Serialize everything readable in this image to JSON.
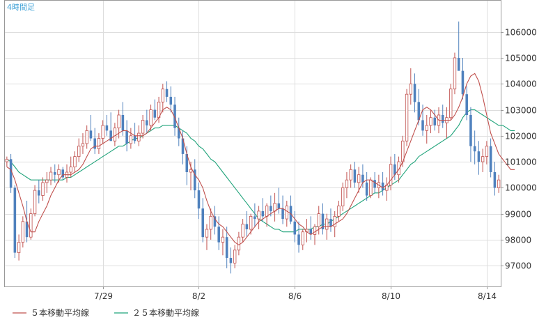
{
  "chart_data": {
    "type": "candlestick",
    "period_label": "4時間足",
    "x_tick_labels": [
      "7/29",
      "8/2",
      "8/6",
      "8/10",
      "8/14"
    ],
    "x_tick_index": [
      24,
      48,
      72,
      96,
      120
    ],
    "ylim": [
      96200,
      107200
    ],
    "y_ticks": [
      97000,
      98000,
      99000,
      100000,
      101000,
      102000,
      103000,
      104000,
      105000,
      106000
    ],
    "grid": true,
    "legend_position": "bottom-left",
    "colors": {
      "up": "#c0504d",
      "down": "#4f81bd",
      "ma5": "#c0504d",
      "ma25": "#1fa37a",
      "grid": "#dddddd",
      "axis": "#999999",
      "period_label": "#3a9fd6"
    },
    "series": [
      {
        "name": "５本移動平均線",
        "key": "ma5"
      },
      {
        "name": "２５本移動平均線",
        "key": "ma25"
      }
    ],
    "candles": [
      [
        101000,
        101200,
        100800,
        101100
      ],
      [
        101100,
        101300,
        99800,
        100000
      ],
      [
        100000,
        100100,
        97300,
        97500
      ],
      [
        97500,
        98200,
        97200,
        97900
      ],
      [
        97900,
        98900,
        97700,
        98700
      ],
      [
        98700,
        99500,
        97900,
        98100
      ],
      [
        98100,
        99200,
        98000,
        99000
      ],
      [
        99000,
        100100,
        98900,
        99900
      ],
      [
        99900,
        100300,
        99400,
        99700
      ],
      [
        99700,
        100400,
        99500,
        100200
      ],
      [
        100200,
        100600,
        99800,
        100300
      ],
      [
        100300,
        100800,
        100100,
        100600
      ],
      [
        100600,
        100900,
        100200,
        100500
      ],
      [
        100500,
        100900,
        100200,
        100700
      ],
      [
        100700,
        100800,
        100300,
        100400
      ],
      [
        100400,
        100900,
        100200,
        100600
      ],
      [
        100600,
        101200,
        100400,
        100800
      ],
      [
        100800,
        101400,
        100600,
        101200
      ],
      [
        101200,
        101900,
        101000,
        101600
      ],
      [
        101600,
        102100,
        101300,
        101700
      ],
      [
        101700,
        102400,
        101500,
        102200
      ],
      [
        102200,
        102800,
        101800,
        101900
      ],
      [
        101900,
        102300,
        101300,
        101500
      ],
      [
        101500,
        102100,
        101300,
        101900
      ],
      [
        101900,
        102600,
        101700,
        102400
      ],
      [
        102400,
        102800,
        102000,
        102200
      ],
      [
        102200,
        102900,
        101800,
        101800
      ],
      [
        101800,
        102500,
        101600,
        102300
      ],
      [
        102300,
        103000,
        101900,
        102800
      ],
      [
        102800,
        103300,
        102000,
        102200
      ],
      [
        102200,
        102600,
        101400,
        101700
      ],
      [
        101700,
        102300,
        101500,
        102000
      ],
      [
        102000,
        102500,
        101700,
        101800
      ],
      [
        101800,
        102400,
        101600,
        102100
      ],
      [
        102100,
        102800,
        101900,
        102600
      ],
      [
        102600,
        103000,
        102100,
        102400
      ],
      [
        102400,
        103200,
        102200,
        103000
      ],
      [
        103000,
        103400,
        102600,
        102700
      ],
      [
        102700,
        103500,
        102500,
        103300
      ],
      [
        103300,
        104000,
        102900,
        103800
      ],
      [
        103800,
        104100,
        103300,
        103500
      ],
      [
        103500,
        103900,
        102900,
        103200
      ],
      [
        103200,
        103500,
        102000,
        102300
      ],
      [
        102300,
        102700,
        101600,
        101900
      ],
      [
        101900,
        102200,
        100900,
        101300
      ],
      [
        101300,
        101600,
        100100,
        100600
      ],
      [
        100600,
        101000,
        99900,
        100700
      ],
      [
        100700,
        101100,
        99600,
        99900
      ],
      [
        99900,
        100200,
        98800,
        99200
      ],
      [
        99200,
        99600,
        97900,
        98100
      ],
      [
        98100,
        98600,
        97600,
        98400
      ],
      [
        98400,
        99200,
        98000,
        98900
      ],
      [
        98900,
        99300,
        98200,
        98500
      ],
      [
        98500,
        98900,
        97600,
        97900
      ],
      [
        97900,
        98400,
        97400,
        98100
      ],
      [
        98100,
        98500,
        96900,
        97300
      ],
      [
        97300,
        97700,
        96700,
        97100
      ],
      [
        97100,
        97800,
        96900,
        97600
      ],
      [
        97600,
        98300,
        97400,
        98100
      ],
      [
        98100,
        98800,
        97900,
        98600
      ],
      [
        98600,
        99100,
        98100,
        98400
      ],
      [
        98400,
        99000,
        98200,
        98900
      ],
      [
        98900,
        99400,
        98500,
        98800
      ],
      [
        98800,
        99300,
        98400,
        99100
      ],
      [
        99100,
        99600,
        98700,
        98900
      ],
      [
        98900,
        99400,
        98500,
        99300
      ],
      [
        99300,
        99700,
        98900,
        99100
      ],
      [
        99100,
        99800,
        98700,
        99400
      ],
      [
        99400,
        100000,
        99000,
        99200
      ],
      [
        99200,
        99700,
        98600,
        98800
      ],
      [
        98800,
        99500,
        98500,
        99300
      ],
      [
        99300,
        99700,
        98600,
        98700
      ],
      [
        98700,
        99100,
        97900,
        98200
      ],
      [
        98200,
        98700,
        97500,
        97800
      ],
      [
        97800,
        98400,
        97600,
        98300
      ],
      [
        98300,
        98800,
        97900,
        98400
      ],
      [
        98400,
        98900,
        98000,
        98200
      ],
      [
        98200,
        98600,
        97800,
        98500
      ],
      [
        98500,
        99300,
        98200,
        99000
      ],
      [
        99000,
        99400,
        98200,
        98400
      ],
      [
        98400,
        99000,
        98000,
        98800
      ],
      [
        98800,
        99200,
        98300,
        98500
      ],
      [
        98500,
        99100,
        98100,
        98900
      ],
      [
        98900,
        99500,
        98700,
        99300
      ],
      [
        99300,
        100200,
        99100,
        100000
      ],
      [
        100000,
        100600,
        99600,
        100300
      ],
      [
        100300,
        100900,
        100000,
        100700
      ],
      [
        100700,
        101000,
        100000,
        100200
      ],
      [
        100200,
        100800,
        99800,
        100500
      ],
      [
        100500,
        100900,
        100000,
        100200
      ],
      [
        100200,
        100600,
        99500,
        99700
      ],
      [
        99700,
        100400,
        99600,
        100300
      ],
      [
        100300,
        100600,
        99800,
        100000
      ],
      [
        100000,
        100500,
        99600,
        100200
      ],
      [
        100200,
        100600,
        99700,
        99900
      ],
      [
        99900,
        100400,
        99500,
        100100
      ],
      [
        100100,
        101200,
        99900,
        100900
      ],
      [
        100900,
        101300,
        100300,
        100500
      ],
      [
        100500,
        101200,
        100200,
        101000
      ],
      [
        101000,
        102000,
        100800,
        101800
      ],
      [
        101800,
        103800,
        101600,
        103600
      ],
      [
        103600,
        104600,
        103200,
        104000
      ],
      [
        104000,
        104400,
        102900,
        103300
      ],
      [
        103300,
        103800,
        102400,
        102600
      ],
      [
        102600,
        103200,
        102000,
        102200
      ],
      [
        102200,
        102800,
        101700,
        102400
      ],
      [
        102400,
        103000,
        102100,
        102700
      ],
      [
        102700,
        103000,
        102200,
        102400
      ],
      [
        102400,
        103100,
        102100,
        102800
      ],
      [
        102800,
        103200,
        102300,
        102500
      ],
      [
        102500,
        103100,
        101900,
        102700
      ],
      [
        102700,
        104000,
        102600,
        103800
      ],
      [
        103800,
        105200,
        103600,
        105000
      ],
      [
        105000,
        106400,
        104600,
        104500
      ],
      [
        104500,
        105000,
        103400,
        103600
      ],
      [
        103600,
        103900,
        102600,
        102800
      ],
      [
        102800,
        103100,
        101000,
        101600
      ],
      [
        101600,
        102200,
        100900,
        101400
      ],
      [
        101400,
        101800,
        100500,
        101000
      ],
      [
        101000,
        101500,
        100600,
        101200
      ],
      [
        101200,
        101800,
        100900,
        101600
      ],
      [
        101600,
        101900,
        100400,
        100600
      ],
      [
        100600,
        101000,
        99700,
        100000
      ],
      [
        100000,
        100500,
        99800,
        100300
      ]
    ],
    "ma5": [
      100800,
      100700,
      100300,
      99800,
      99300,
      98700,
      98300,
      98300,
      98700,
      99000,
      99300,
      99700,
      100000,
      100300,
      100500,
      100500,
      100500,
      100600,
      100700,
      100900,
      101200,
      101500,
      101600,
      101600,
      101700,
      101800,
      101900,
      102000,
      102100,
      102200,
      102200,
      102100,
      102000,
      102000,
      102000,
      102100,
      102300,
      102500,
      102700,
      103000,
      103100,
      103000,
      102700,
      102300,
      101900,
      101300,
      100800,
      100500,
      100300,
      100000,
      99500,
      99100,
      98800,
      98600,
      98500,
      98300,
      98100,
      97900,
      97800,
      97900,
      98100,
      98300,
      98500,
      98700,
      98800,
      98900,
      99000,
      99100,
      99200,
      99200,
      99100,
      99000,
      98800,
      98600,
      98500,
      98300,
      98200,
      98300,
      98400,
      98500,
      98500,
      98500,
      98600,
      98700,
      98800,
      99000,
      99300,
      99600,
      99900,
      100200,
      100300,
      100300,
      100200,
      100100,
      100000,
      100100,
      100300,
      100500,
      100700,
      101000,
      101400,
      101800,
      102200,
      102600,
      103000,
      103100,
      103000,
      102800,
      102600,
      102600,
      102600,
      102600,
      102800,
      103100,
      103500,
      104000,
      104300,
      104400,
      104100,
      103500,
      102800,
      102100,
      101700,
      101300,
      101100,
      100900,
      100700,
      100700
    ],
    "ma25": [
      101100,
      101000,
      100800,
      100600,
      100500,
      100400,
      100300,
      100300,
      100300,
      100300,
      100300,
      100300,
      100300,
      100300,
      100300,
      100400,
      100400,
      100500,
      100600,
      100700,
      100800,
      100900,
      101000,
      101100,
      101200,
      101300,
      101400,
      101500,
      101600,
      101600,
      101700,
      101800,
      101900,
      101900,
      102000,
      102100,
      102200,
      102300,
      102300,
      102400,
      102400,
      102400,
      102400,
      102300,
      102200,
      102100,
      101900,
      101800,
      101600,
      101500,
      101300,
      101100,
      101000,
      100800,
      100600,
      100400,
      100200,
      100000,
      99800,
      99600,
      99400,
      99200,
      99000,
      98800,
      98700,
      98600,
      98500,
      98400,
      98400,
      98300,
      98300,
      98300,
      98300,
      98400,
      98400,
      98400,
      98400,
      98500,
      98500,
      98600,
      98600,
      98700,
      98800,
      98900,
      99000,
      99100,
      99200,
      99300,
      99400,
      99500,
      99600,
      99700,
      99800,
      99800,
      99900,
      100000,
      100100,
      100200,
      100300,
      100500,
      100700,
      100900,
      101000,
      101200,
      101300,
      101400,
      101500,
      101600,
      101700,
      101800,
      101900,
      102000,
      102200,
      102400,
      102700,
      102900,
      103000,
      103000,
      102900,
      102800,
      102700,
      102600,
      102500,
      102400,
      102400,
      102300,
      102200,
      102200
    ]
  }
}
